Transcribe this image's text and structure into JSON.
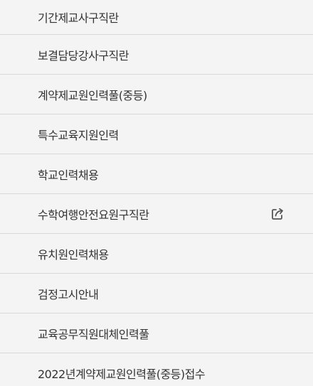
{
  "menu": {
    "items": [
      {
        "label": "기간제교사구직란"
      },
      {
        "label": "보결담당강사구직란"
      },
      {
        "label": "계약제교원인력풀(중등)"
      },
      {
        "label": "특수교육지원인력"
      },
      {
        "label": "학교인력채용"
      },
      {
        "label": "수학여행안전요원구직란",
        "icon": "external-link-icon"
      },
      {
        "label": "유치원인력채용"
      },
      {
        "label": "검정고시안내"
      },
      {
        "label": "교육공무직원대체인력풀"
      },
      {
        "label": "2022년계약제교원인력풀(중등)접수"
      }
    ]
  },
  "colors": {
    "background": "#f4f4f4",
    "divider": "#d9d9d9",
    "text": "#333333",
    "icon": "#555555"
  }
}
